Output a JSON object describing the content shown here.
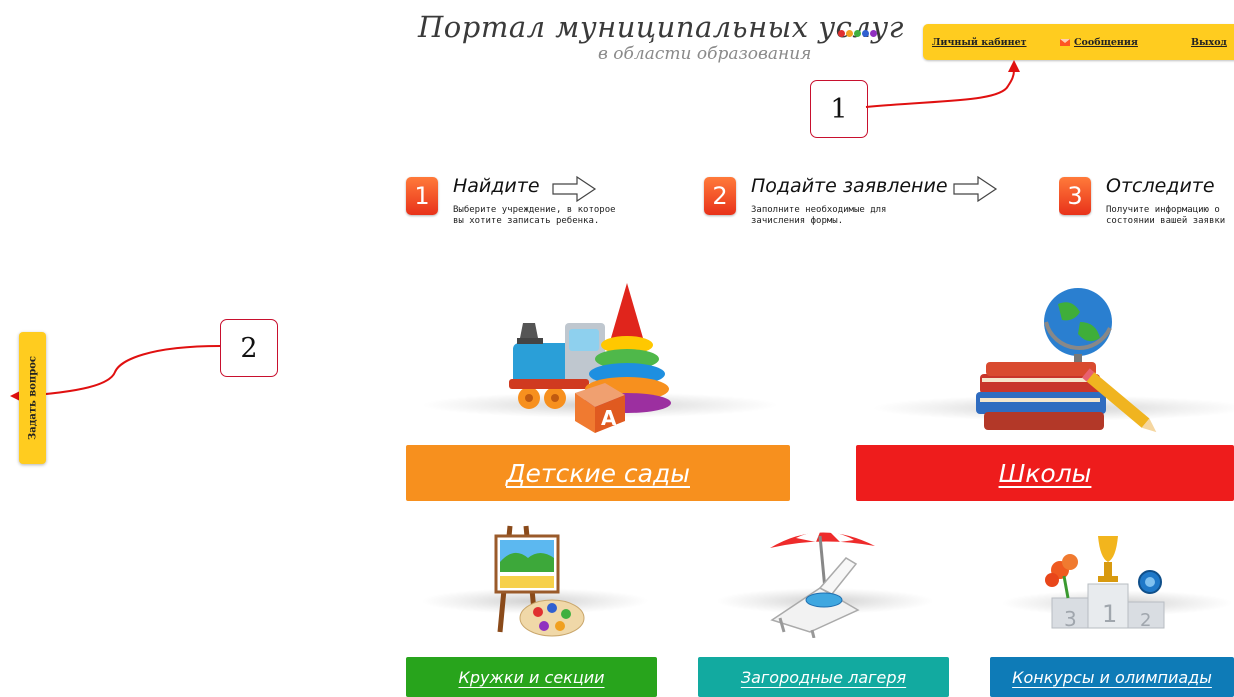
{
  "logo": {
    "title": "Портал муниципальных услуг",
    "subtitle": "в области образования",
    "dot_colors": [
      "#e03030",
      "#f0a020",
      "#40b040",
      "#3060d0",
      "#9030c0"
    ]
  },
  "userbar": {
    "cabinet": "Личный кабинет",
    "messages": "Сообщения",
    "exit": "Выход",
    "messages_icon": "envelope-icon",
    "color": "#ffcc1f"
  },
  "callouts": {
    "first": "1",
    "second": "2"
  },
  "side_tab": {
    "label": "Задать вопрос"
  },
  "steps": [
    {
      "number": "1",
      "title": "Найдите",
      "desc_line1": "Выберите учреждение, в которое",
      "desc_line2": "вы хотите записать ребенка."
    },
    {
      "number": "2",
      "title": "Подайте заявление",
      "desc_line1": "Заполните необходимые для",
      "desc_line2": "зачисления формы."
    },
    {
      "number": "3",
      "title": "Отследите",
      "desc_line1": "Получите информацию о",
      "desc_line2": "состоянии вашей заявки"
    }
  ],
  "categories": [
    {
      "label": "Детские сады",
      "color": "#f7901e",
      "icon": "toys-icon"
    },
    {
      "label": "Школы",
      "color": "#ee1c1c",
      "icon": "globe-books-icon"
    },
    {
      "label": "Кружки и секции",
      "color": "#28a41c",
      "icon": "easel-palette-icon"
    },
    {
      "label": "Загородные лагеря",
      "color": "#12aaa0",
      "icon": "beach-chair-icon"
    },
    {
      "label": "Конкурсы и олимпиады",
      "color": "#0e7bb7",
      "icon": "trophy-podium-icon"
    }
  ]
}
